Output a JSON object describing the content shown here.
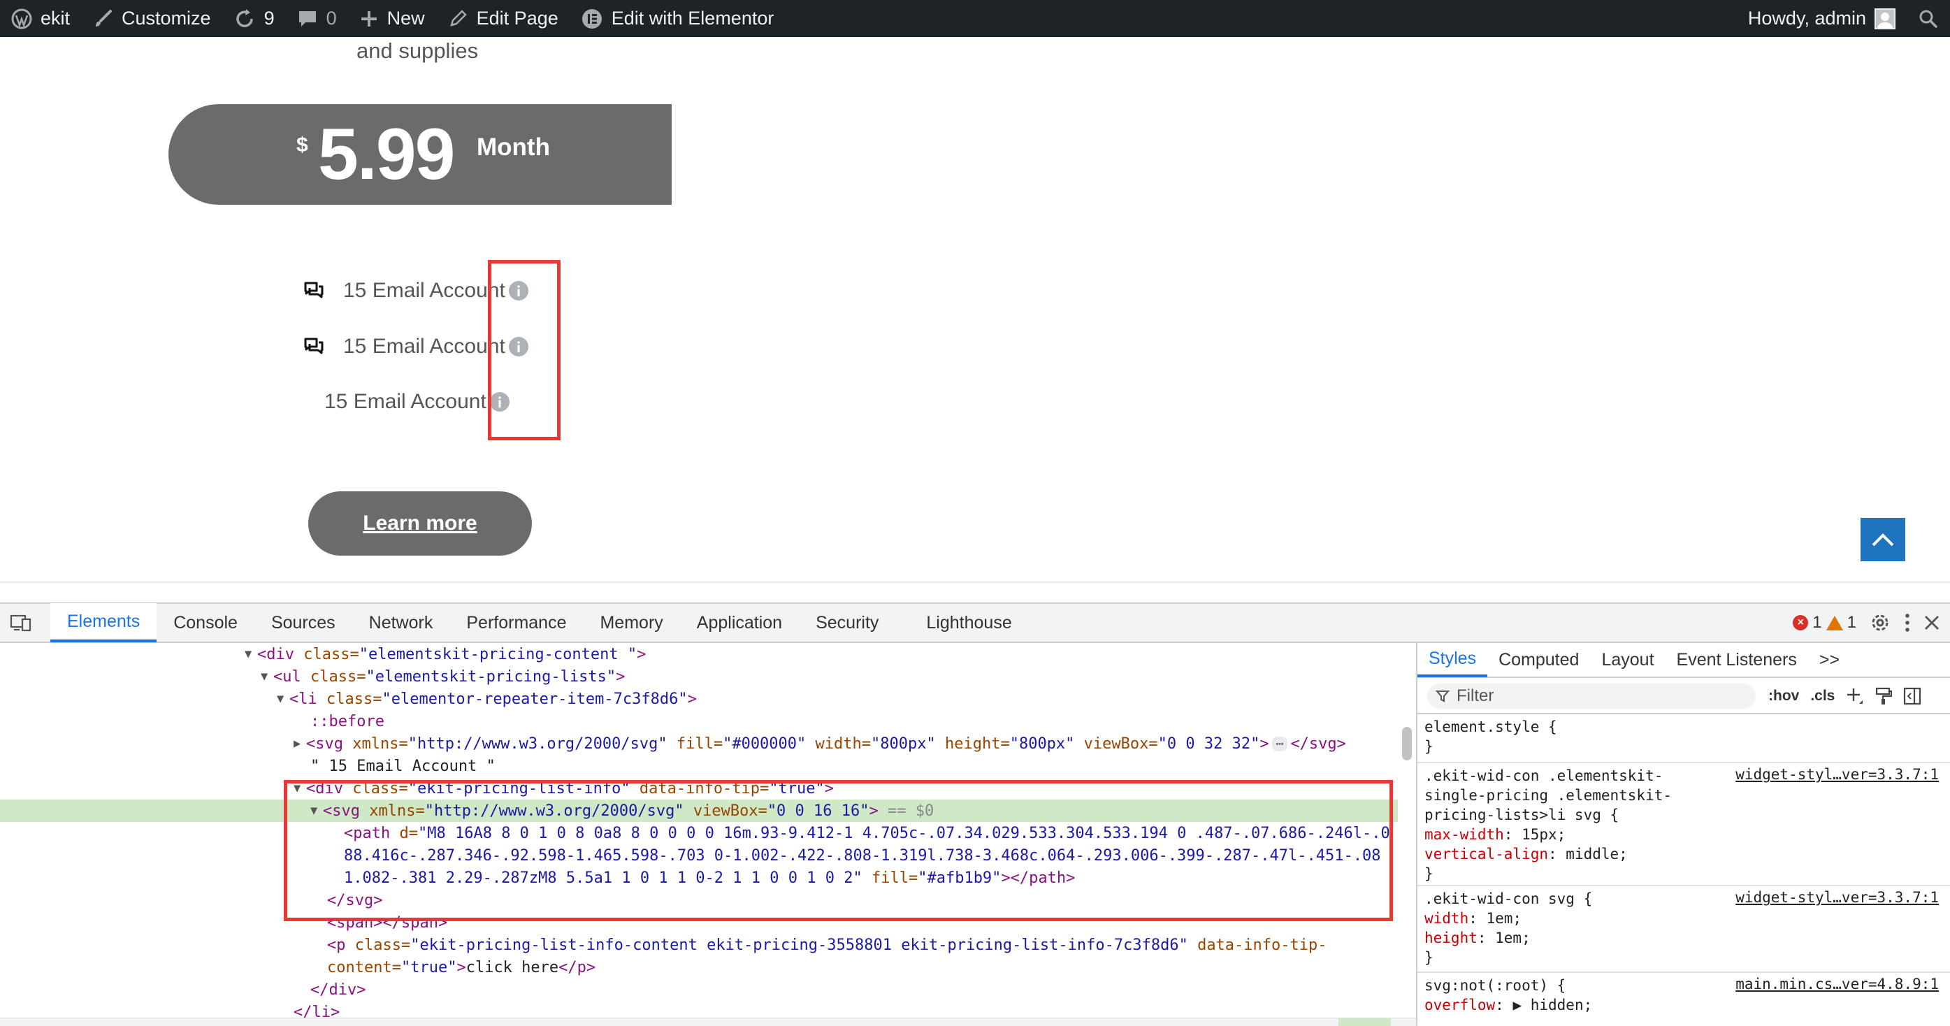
{
  "adminbar": {
    "site_name": "ekit",
    "customize": "Customize",
    "updates_count": "9",
    "comments_count": "0",
    "new_label": "New",
    "edit_page": "Edit Page",
    "edit_elementor": "Edit with Elementor",
    "howdy": "Howdy, admin"
  },
  "pricing": {
    "top_text": "and supplies",
    "currency": "$",
    "price": "5.99",
    "period": "Month",
    "items": [
      {
        "label": "15 Email Account"
      },
      {
        "label": "15 Email Account"
      },
      {
        "label": "15 Email Account"
      }
    ],
    "button_label": "Learn more"
  },
  "devtools": {
    "tabs": [
      "Elements",
      "Console",
      "Sources",
      "Network",
      "Performance",
      "Memory",
      "Application",
      "Security",
      "Lighthouse"
    ],
    "active_tab": "Elements",
    "error_count": "1",
    "warning_count": "1",
    "dom": {
      "l1_tag": "<div ",
      "l1_attr": "class=",
      "l1_val": "\"elementskit-pricing-content \"",
      "l1_end": ">",
      "l2_tag": "<ul ",
      "l2_attr": "class=",
      "l2_val": "\"elementskit-pricing-lists\"",
      "l2_end": ">",
      "l3_tag": "<li ",
      "l3_attr": "class=",
      "l3_val": "\"elementor-repeater-item-7c3f8d6\"",
      "l3_end": ">",
      "l4_pseudo": "::before",
      "l5_tag": "<svg ",
      "l5_a1": "xmlns=",
      "l5_v1": "\"http://www.w3.org/2000/svg\"",
      "l5_a2": " fill=",
      "l5_v2": "\"#000000\"",
      "l5_a3": " width=",
      "l5_v3": "\"800px\"",
      "l5_a4": " height=",
      "l5_v4": "\"800px\"",
      "l5_a5": " viewBox=",
      "l5_v5": "\"0 0 32 32\"",
      "l5_close": "</svg>",
      "l6_text": "\" 15 Email Account \"",
      "l7_tag": "<div ",
      "l7_a1": "class=",
      "l7_v1": "\"ekit-pricing-list-info\"",
      "l7_a2": " data-info-tip=",
      "l7_v2": "\"true\"",
      "l7_end": ">",
      "l8_tag": "<svg ",
      "l8_a1": "xmlns=",
      "l8_v1": "\"http://www.w3.org/2000/svg\"",
      "l8_a2": " viewBox=",
      "l8_v2": "\"0 0 16 16\"",
      "l8_end": ">",
      "l8_eq": " == $0",
      "l9_tag": "<path ",
      "l9_a1": "d=",
      "l9_v1": "\"M8 16A8 8 0 1 0 8 0a8 8 0 0 0 0 16m.93-9.412-1 4.705c-.07.34.029.533.304.533.194 0 .487-.07.686-.246l-.0",
      "l10_v": "88.416c-.287.346-.92.598-1.465.598-.703 0-1.002-.422-.808-1.319l.738-3.468c.064-.293.006-.399-.287-.47l-.451-.08",
      "l11_v": "1.082-.381 2.29-.287zM8 5.5a1 1 0 1 1 0-2 1 1 0 0 1 0 2\"",
      "l11_a2": " fill=",
      "l11_v2": "\"#afb1b9\"",
      "l11_end": "></path>",
      "l12_close": "</svg>",
      "l13_text": "<span></span>",
      "l14_tag": "<p ",
      "l14_a1": "class=",
      "l14_v1": "\"ekit-pricing-list-info-content ekit-pricing-3558801 ekit-pricing-list-info-7c3f8d6\"",
      "l14_a2": " data-info-tip-",
      "l15_a": "content=",
      "l15_v": "\"true\"",
      "l15_end": ">",
      "l15_text": "click here",
      "l15_close": "</p>",
      "l16_close": "</div>",
      "l17_close": "</li>"
    },
    "styles": {
      "tabs": [
        "Styles",
        "Computed",
        "Layout",
        "Event Listeners"
      ],
      "more": ">>",
      "filter_placeholder": "Filter",
      "hov": ":hov",
      "cls": ".cls",
      "r0_sel": "element.style {",
      "r0_close": "}",
      "r1_sel1": ".ekit-wid-con .elementskit-",
      "r1_sel2": "single-pricing .elementskit-",
      "r1_sel3": "pricing-lists>li svg {",
      "r1_src": "widget-styl…ver=3.3.7:1",
      "r1_p1n": "max-width",
      "r1_p1v": ": 15px;",
      "r1_p2n": "vertical-align",
      "r1_p2v": ": middle;",
      "r1_close": "}",
      "r2_sel": ".ekit-wid-con svg {",
      "r2_src": "widget-styl…ver=3.3.7:1",
      "r2_p1n": "width",
      "r2_p1v": ": 1em;",
      "r2_p2n": "height",
      "r2_p2v": ": 1em;",
      "r2_close": "}",
      "r3_sel": "svg:not(:root) {",
      "r3_src": "main.min.cs…ver=4.8.9:1",
      "r3_p1n": "overflow",
      "r3_p1v": "hidden;"
    }
  }
}
